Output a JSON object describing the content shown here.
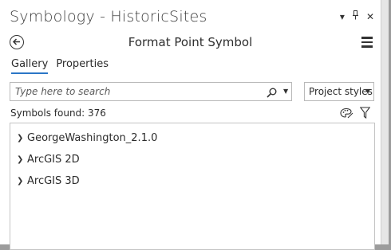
{
  "pane": {
    "title": "Symbology - HistoricSites",
    "title_icons": [
      "pin-dropdown-icon",
      "pin-icon",
      "close-icon"
    ]
  },
  "header": {
    "subtitle": "Format Point Symbol"
  },
  "tabs": [
    {
      "label": "Gallery",
      "active": true
    },
    {
      "label": "Properties",
      "active": false
    }
  ],
  "search": {
    "placeholder": "Type here to search",
    "value": ""
  },
  "style_select": {
    "selected": "Project styles"
  },
  "results": {
    "count_text": "Symbols found: 376"
  },
  "groups": [
    {
      "label": "GeorgeWashington_2.1.0"
    },
    {
      "label": "ArcGIS 2D"
    },
    {
      "label": "ArcGIS 3D"
    }
  ],
  "colors": {
    "accent": "#2b76c6",
    "border": "#b9b9b9"
  }
}
